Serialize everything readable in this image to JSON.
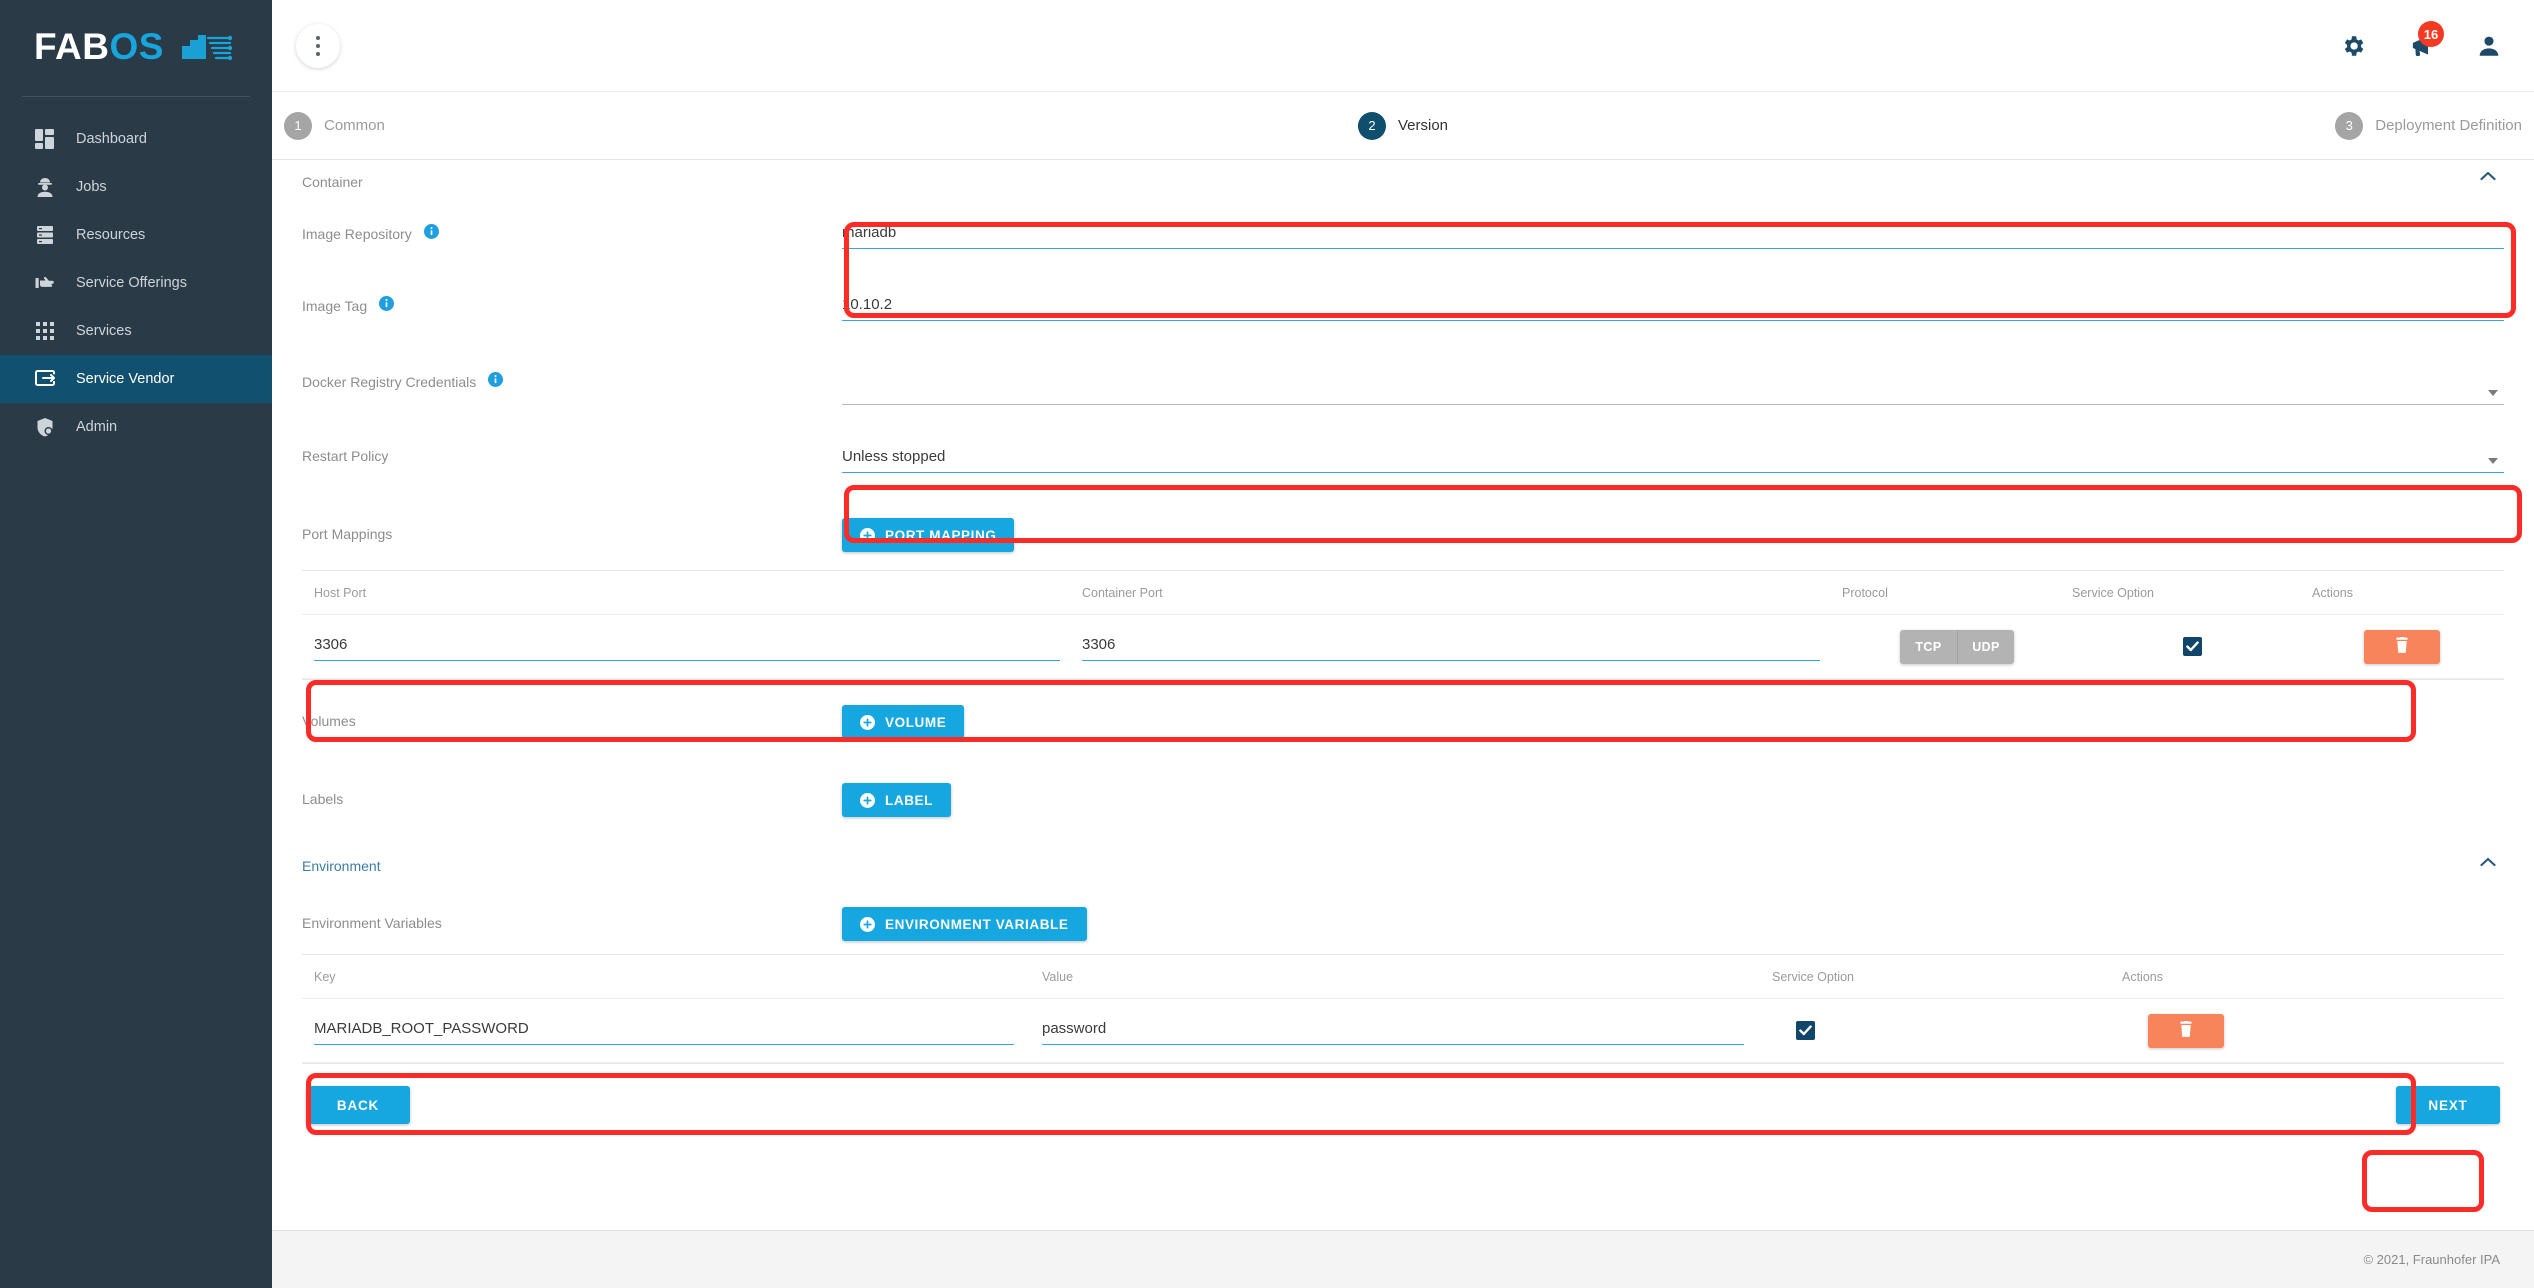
{
  "brand": {
    "name_part1": "FAB",
    "name_part2": "OS",
    "logo_icon": "circuit-factory-logo"
  },
  "sidebar": {
    "items": [
      {
        "label": "Dashboard",
        "icon": "dashboard-icon",
        "active": false
      },
      {
        "label": "Jobs",
        "icon": "worker-icon",
        "active": false
      },
      {
        "label": "Resources",
        "icon": "server-rack-icon",
        "active": false
      },
      {
        "label": "Service Offerings",
        "icon": "hand-pointing-icon",
        "active": false
      },
      {
        "label": "Services",
        "icon": "grid-dots-icon",
        "active": false
      },
      {
        "label": "Service Vendor",
        "icon": "service-vendor-icon",
        "active": true
      },
      {
        "label": "Admin",
        "icon": "shield-user-icon",
        "active": false
      }
    ]
  },
  "topbar": {
    "menu_icon": "kebab-menu-icon",
    "settings_icon": "gear-icon",
    "announcements_icon": "megaphone-icon",
    "announcements_badge": "16",
    "account_icon": "person-icon"
  },
  "stepper": {
    "steps": [
      {
        "num": "1",
        "label": "Common",
        "state": "inactive"
      },
      {
        "num": "2",
        "label": "Version",
        "state": "active"
      },
      {
        "num": "3",
        "label": "Deployment Definition",
        "state": "inactive"
      }
    ]
  },
  "container_section": {
    "title": "Container",
    "collapse_icon": "chevron-up-icon",
    "fields": {
      "image_repository": {
        "label": "Image Repository",
        "info_icon": "info-icon",
        "value": "mariadb"
      },
      "image_tag": {
        "label": "Image Tag",
        "info_icon": "info-icon",
        "value": "10.10.2"
      },
      "docker_registry_credentials": {
        "label": "Docker Registry Credentials",
        "info_icon": "info-icon",
        "value": "",
        "caret_icon": "chevron-down-icon"
      },
      "restart_policy": {
        "label": "Restart Policy",
        "value": "Unless stopped",
        "caret_icon": "chevron-down-icon"
      }
    },
    "port_mappings": {
      "label": "Port Mappings",
      "add_button": {
        "label": "PORT MAPPING",
        "icon": "plus-circle-icon"
      },
      "columns": [
        "Host Port",
        "Container Port",
        "Protocol",
        "Service Option",
        "Actions"
      ],
      "rows": [
        {
          "host_port": "3306",
          "container_port": "3306",
          "protocol_options": [
            "TCP",
            "UDP"
          ],
          "protocol_selected": "",
          "service_option": true,
          "delete_icon": "trash-icon"
        }
      ]
    },
    "volumes": {
      "label": "Volumes",
      "add_button": {
        "label": "VOLUME",
        "icon": "plus-circle-icon"
      }
    },
    "labels": {
      "label": "Labels",
      "add_button": {
        "label": "LABEL",
        "icon": "plus-circle-icon"
      }
    }
  },
  "environment_section": {
    "title": "Environment",
    "collapse_icon": "chevron-up-icon",
    "environment_variables": {
      "label": "Environment Variables",
      "add_button": {
        "label": "ENVIRONMENT VARIABLE",
        "icon": "plus-circle-icon"
      },
      "columns": [
        "Key",
        "Value",
        "Service Option",
        "Actions"
      ],
      "rows": [
        {
          "key": "MARIADB_ROOT_PASSWORD",
          "value": "password",
          "service_option": true,
          "delete_icon": "trash-icon"
        }
      ]
    }
  },
  "wizard_actions": {
    "back_label": "BACK",
    "next_label": "NEXT"
  },
  "footer": {
    "copyright": "© 2021, Fraunhofer IPA"
  },
  "colors": {
    "sidebar_bg": "#2a3a47",
    "sidebar_active": "#11506f",
    "brand_blue": "#18a5dc",
    "accent_blue": "#16a6e0",
    "field_underline": "#2fa8e8",
    "step_active": "#0f4f6e",
    "badge_red": "#f33a23",
    "delete_orange": "#f7845a",
    "protocol_grey": "#b3b3b3",
    "annotation_red": "#fb2c28",
    "checkbox_navy": "#12456a"
  }
}
